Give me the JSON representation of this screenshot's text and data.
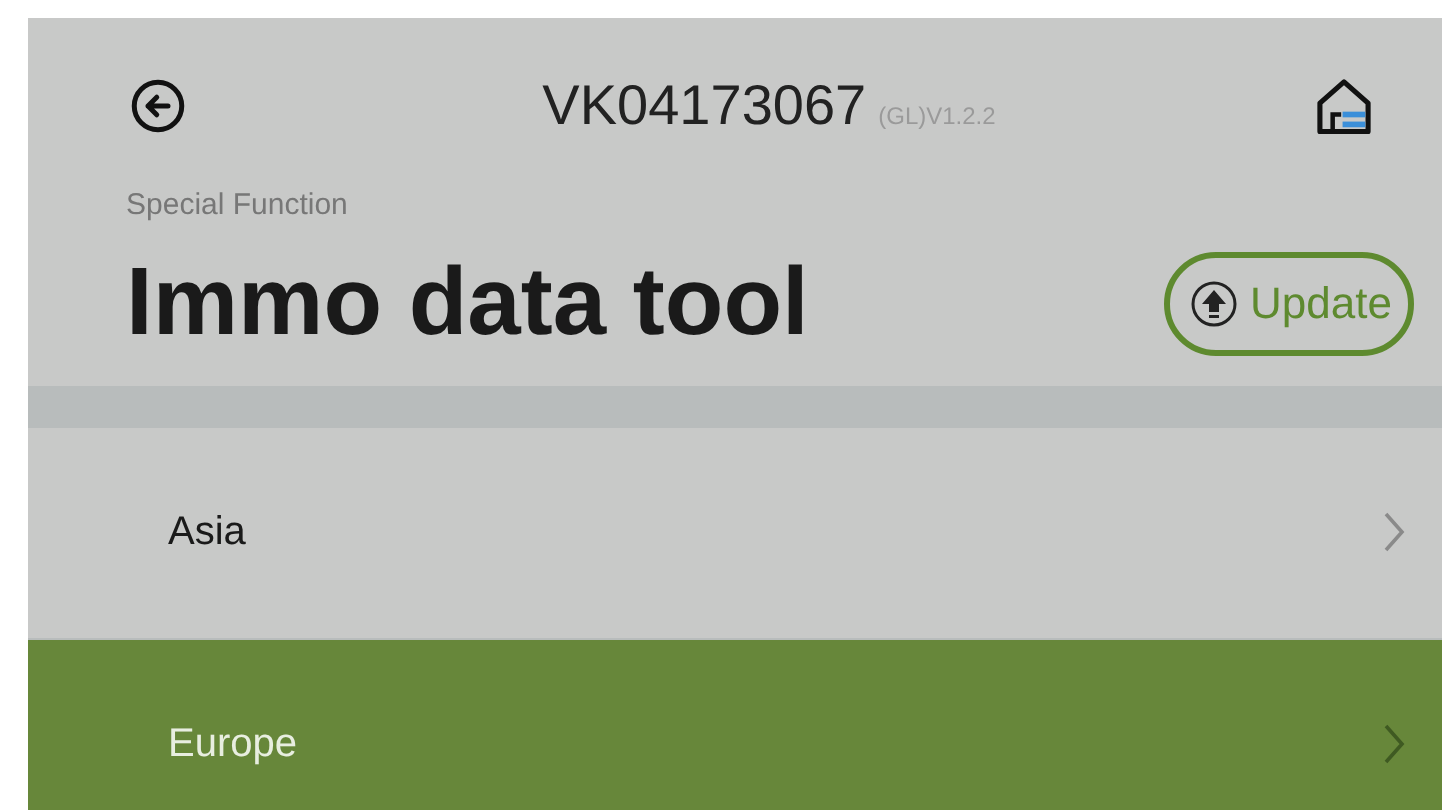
{
  "header": {
    "serial": "VK04173067",
    "version": "(GL)V1.2.2"
  },
  "breadcrumb": "Special Function",
  "title": "Immo data tool",
  "update_button": {
    "label": "Update"
  },
  "regions": [
    {
      "label": "Asia",
      "selected": false
    },
    {
      "label": "Europe",
      "selected": true
    }
  ]
}
